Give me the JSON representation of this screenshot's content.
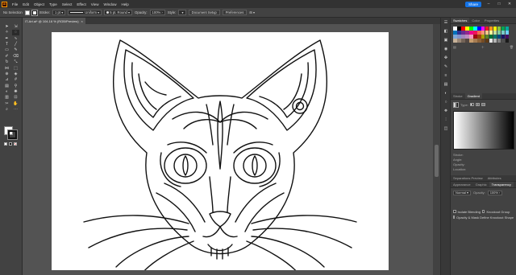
{
  "menubar": {
    "logo": "Ai",
    "items": [
      "File",
      "Edit",
      "Object",
      "Type",
      "Select",
      "Effect",
      "View",
      "Window",
      "Help"
    ],
    "share_label": "Share"
  },
  "controlbar": {
    "selection_label": "No Selection",
    "stroke_label": "Stroke:",
    "stroke_weight": "1 pt",
    "stroke_profile": "Uniform",
    "brush": "5 pt. Round",
    "opacity_label": "Opacity:",
    "opacity_value": "100%",
    "style_label": "Style:",
    "document_setup": "Document Setup",
    "preferences": "Preferences"
  },
  "tab": {
    "title": "IT-Art.ai* @ 104.16 % (RGB/Preview)",
    "close": "×"
  },
  "panels": {
    "swatch_tabs": [
      "Swatches",
      "Color",
      "Properties"
    ],
    "stroke_tabs": [
      "Stroke",
      "Gradient"
    ],
    "gradient_type_label": "Type:",
    "gradient_rows": [
      "Stroke:",
      "Angle:",
      "Opacity:",
      "Location:"
    ],
    "transparency_tabs": [
      "Appearance",
      "Graphic",
      "Transparency"
    ],
    "blend_mode": "Normal",
    "opacity_label": "Opacity:",
    "opacity_value": "100%",
    "separations_label": "Separations Preview",
    "attributes_label": "Attributes",
    "isolate_blending": "Isolate Blending",
    "knockout_group": "Knockout Group",
    "opacity_mask": "Opacity & Mask Define Knockout Shape"
  },
  "colors": {
    "accent": "#1473e6",
    "chrome": "#323232",
    "panel": "#424242",
    "canvas": "#535353"
  },
  "swatch_colors": [
    "#ffffff",
    "#000000",
    "#ff0000",
    "#ffff00",
    "#00ff00",
    "#00ffff",
    "#0000ff",
    "#ff00ff",
    "#ed1c24",
    "#f7941d",
    "#fff200",
    "#8dc63f",
    "#00a651",
    "#00a99d",
    "#0072bc",
    "#2e3192",
    "#662d91",
    "#92278f",
    "#ec008c",
    "#ed145b",
    "#f26c4f",
    "#f69679",
    "#fdc689",
    "#fff799",
    "#c4df9b",
    "#82ca9c",
    "#7accc8",
    "#6dcff6",
    "#7da7d9",
    "#8393ca",
    "#a187be",
    "#bd8cbf",
    "#f49ac1",
    "#9e0b0f",
    "#a0410d",
    "#aba000",
    "#598527",
    "#007236",
    "#00746b",
    "#004a80",
    "#1b1464",
    "#440e62",
    "#c7b299",
    "#998675",
    "#736357",
    "#534741",
    "#c69c6d",
    "#a67c52",
    "#8c6239",
    "#754c24",
    "#603913",
    "#e6e6e6",
    "#b3b3b3",
    "#808080",
    "#4d4d4d",
    "#1a1a1a"
  ]
}
